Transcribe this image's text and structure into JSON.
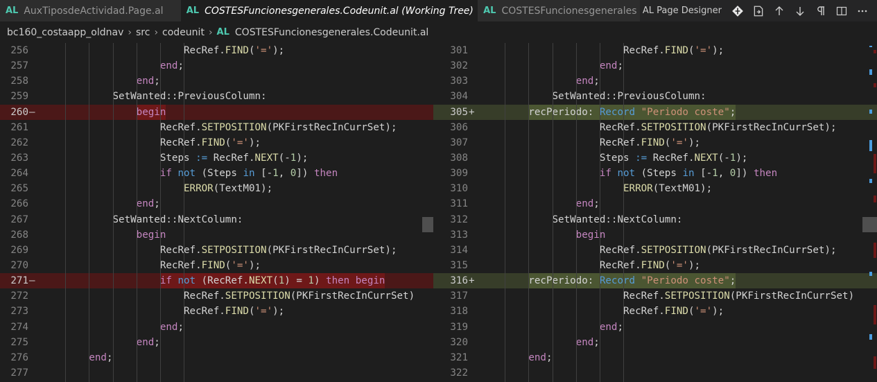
{
  "tabs": [
    {
      "lang": "AL",
      "title": "AuxTiposdeActividad.Page.al",
      "active": false
    },
    {
      "lang": "AL",
      "title": "COSTESFuncionesgenerales.Codeunit.al (Working Tree)",
      "active": true,
      "close": "✕"
    },
    {
      "lang": "AL",
      "title": "COSTESFuncionesgenerales",
      "active": false
    }
  ],
  "actions": {
    "page_designer": "AL Page Designer",
    "icons": [
      "git-compare-icon",
      "open-file-icon",
      "arrow-up-icon",
      "arrow-down-icon",
      "pilcrow-icon",
      "split-editor-icon",
      "more-icon"
    ]
  },
  "breadcrumb": {
    "items": [
      "bc160_costaapp_oldnav",
      "src",
      "codeunit"
    ],
    "file_lang": "AL",
    "file": "COSTESFuncionesgenerales.Codeunit.al"
  },
  "colors": {
    "removed_line": "#4b1818",
    "added_line": "#373d29",
    "editor_bg": "#1e1e1e"
  },
  "left_lines": [
    {
      "n": "256",
      "mark": "",
      "type": "normal",
      "indent": 6,
      "tokens": [
        [
          "RecRef.",
          ""
        ],
        [
          "FIND",
          "fn"
        ],
        [
          "(",
          ""
        ],
        [
          "'='",
          "st"
        ],
        [
          ");",
          ""
        ]
      ]
    },
    {
      "n": "257",
      "mark": "",
      "type": "normal",
      "indent": 5,
      "tokens": [
        [
          "end",
          "ctl"
        ],
        [
          ";",
          ""
        ]
      ]
    },
    {
      "n": "258",
      "mark": "",
      "type": "normal",
      "indent": 4,
      "tokens": [
        [
          "end",
          "ctl"
        ],
        [
          ";",
          ""
        ]
      ]
    },
    {
      "n": "259",
      "mark": "",
      "type": "normal",
      "indent": 3,
      "tokens": [
        [
          "SetWanted::PreviousColumn:",
          ""
        ]
      ]
    },
    {
      "n": "260",
      "mark": "—",
      "type": "removed",
      "indent": 4,
      "tokens": [
        [
          "begin",
          "ctl"
        ]
      ]
    },
    {
      "n": "261",
      "mark": "",
      "type": "normal",
      "indent": 5,
      "tokens": [
        [
          "RecRef.",
          ""
        ],
        [
          "SETPOSITION",
          "fn"
        ],
        [
          "(PKFirstRecInCurrSet);",
          ""
        ]
      ]
    },
    {
      "n": "262",
      "mark": "",
      "type": "normal",
      "indent": 5,
      "tokens": [
        [
          "RecRef.",
          ""
        ],
        [
          "FIND",
          "fn"
        ],
        [
          "(",
          ""
        ],
        [
          "'='",
          "st"
        ],
        [
          ");",
          ""
        ]
      ]
    },
    {
      "n": "263",
      "mark": "",
      "type": "normal",
      "indent": 5,
      "tokens": [
        [
          "Steps ",
          ""
        ],
        [
          ":=",
          "kw"
        ],
        [
          " RecRef.",
          ""
        ],
        [
          "NEXT",
          "fn"
        ],
        [
          "(-",
          ""
        ],
        [
          "1",
          "nm"
        ],
        [
          ");",
          ""
        ]
      ]
    },
    {
      "n": "264",
      "mark": "",
      "type": "normal",
      "indent": 5,
      "tokens": [
        [
          "if",
          "ctl"
        ],
        [
          " ",
          ""
        ],
        [
          "not",
          "kw"
        ],
        [
          " (Steps ",
          ""
        ],
        [
          "in",
          "kw"
        ],
        [
          " [-",
          ""
        ],
        [
          "1",
          "nm"
        ],
        [
          ", ",
          ""
        ],
        [
          "0",
          "nm"
        ],
        [
          "]) ",
          ""
        ],
        [
          "then",
          "ctl"
        ]
      ]
    },
    {
      "n": "265",
      "mark": "",
      "type": "normal",
      "indent": 6,
      "tokens": [
        [
          "ERROR",
          "fn"
        ],
        [
          "(TextM01);",
          ""
        ]
      ]
    },
    {
      "n": "266",
      "mark": "",
      "type": "normal",
      "indent": 4,
      "tokens": [
        [
          "end",
          "ctl"
        ],
        [
          ";",
          ""
        ]
      ]
    },
    {
      "n": "267",
      "mark": "",
      "type": "normal",
      "indent": 3,
      "tokens": [
        [
          "SetWanted::NextColumn:",
          ""
        ]
      ]
    },
    {
      "n": "268",
      "mark": "",
      "type": "normal",
      "indent": 4,
      "tokens": [
        [
          "begin",
          "ctl"
        ]
      ]
    },
    {
      "n": "269",
      "mark": "",
      "type": "normal",
      "indent": 5,
      "tokens": [
        [
          "RecRef.",
          ""
        ],
        [
          "SETPOSITION",
          "fn"
        ],
        [
          "(PKFirstRecInCurrSet);",
          ""
        ]
      ]
    },
    {
      "n": "270",
      "mark": "",
      "type": "normal",
      "indent": 5,
      "tokens": [
        [
          "RecRef.",
          ""
        ],
        [
          "FIND",
          "fn"
        ],
        [
          "(",
          ""
        ],
        [
          "'='",
          "st"
        ],
        [
          ");",
          ""
        ]
      ]
    },
    {
      "n": "271",
      "mark": "—",
      "type": "removed",
      "indent": 5,
      "tokens": [
        [
          "if",
          "ctl"
        ],
        [
          " ",
          ""
        ],
        [
          "not",
          "kw"
        ],
        [
          " (RecRef.",
          ""
        ],
        [
          "NEXT",
          "fn"
        ],
        [
          "(",
          ""
        ],
        [
          "1",
          "nm"
        ],
        [
          ") = ",
          ""
        ],
        [
          "1",
          "nm"
        ],
        [
          ") ",
          ""
        ],
        [
          "then",
          "ctl"
        ],
        [
          " ",
          ""
        ],
        [
          "begin",
          "ctl"
        ]
      ]
    },
    {
      "n": "272",
      "mark": "",
      "type": "normal",
      "indent": 6,
      "tokens": [
        [
          "RecRef.",
          ""
        ],
        [
          "SETPOSITION",
          "fn"
        ],
        [
          "(PKFirstRecInCurrSet)",
          ""
        ]
      ]
    },
    {
      "n": "273",
      "mark": "",
      "type": "normal",
      "indent": 6,
      "tokens": [
        [
          "RecRef.",
          ""
        ],
        [
          "FIND",
          "fn"
        ],
        [
          "(",
          ""
        ],
        [
          "'='",
          "st"
        ],
        [
          ");",
          ""
        ]
      ]
    },
    {
      "n": "274",
      "mark": "",
      "type": "normal",
      "indent": 5,
      "tokens": [
        [
          "end",
          "ctl"
        ],
        [
          ";",
          ""
        ]
      ]
    },
    {
      "n": "275",
      "mark": "",
      "type": "normal",
      "indent": 4,
      "tokens": [
        [
          "end",
          "ctl"
        ],
        [
          ";",
          ""
        ]
      ]
    },
    {
      "n": "276",
      "mark": "",
      "type": "normal",
      "indent": 2,
      "tokens": [
        [
          "end",
          "ctl"
        ],
        [
          ";",
          ""
        ]
      ]
    },
    {
      "n": "277",
      "mark": "",
      "type": "normal",
      "indent": 0,
      "tokens": []
    }
  ],
  "right_lines": [
    {
      "n": "301",
      "mark": "",
      "type": "normal",
      "indent": 6,
      "tokens": [
        [
          "RecRef.",
          ""
        ],
        [
          "FIND",
          "fn"
        ],
        [
          "(",
          ""
        ],
        [
          "'='",
          "st"
        ],
        [
          ");",
          ""
        ]
      ]
    },
    {
      "n": "302",
      "mark": "",
      "type": "normal",
      "indent": 5,
      "tokens": [
        [
          "end",
          "ctl"
        ],
        [
          ";",
          ""
        ]
      ]
    },
    {
      "n": "303",
      "mark": "",
      "type": "normal",
      "indent": 4,
      "tokens": [
        [
          "end",
          "ctl"
        ],
        [
          ";",
          ""
        ]
      ]
    },
    {
      "n": "304",
      "mark": "",
      "type": "normal",
      "indent": 3,
      "tokens": [
        [
          "SetWanted::PreviousColumn:",
          ""
        ]
      ]
    },
    {
      "n": "305",
      "mark": "+",
      "type": "added",
      "indent": 2,
      "tokens": [
        [
          "recPeriodo",
          ""
        ],
        [
          ": ",
          ""
        ],
        [
          "Record",
          "kw"
        ],
        [
          " ",
          ""
        ],
        [
          "\"Periodo coste\"",
          "st"
        ],
        [
          ";",
          ""
        ]
      ]
    },
    {
      "n": "306",
      "mark": "",
      "type": "normal",
      "indent": 5,
      "tokens": [
        [
          "RecRef.",
          ""
        ],
        [
          "SETPOSITION",
          "fn"
        ],
        [
          "(PKFirstRecInCurrSet);",
          ""
        ]
      ]
    },
    {
      "n": "307",
      "mark": "",
      "type": "normal",
      "indent": 5,
      "tokens": [
        [
          "RecRef.",
          ""
        ],
        [
          "FIND",
          "fn"
        ],
        [
          "(",
          ""
        ],
        [
          "'='",
          "st"
        ],
        [
          ");",
          ""
        ]
      ]
    },
    {
      "n": "308",
      "mark": "",
      "type": "normal",
      "indent": 5,
      "tokens": [
        [
          "Steps ",
          ""
        ],
        [
          ":=",
          "kw"
        ],
        [
          " RecRef.",
          ""
        ],
        [
          "NEXT",
          "fn"
        ],
        [
          "(-",
          ""
        ],
        [
          "1",
          "nm"
        ],
        [
          ");",
          ""
        ]
      ]
    },
    {
      "n": "309",
      "mark": "",
      "type": "normal",
      "indent": 5,
      "tokens": [
        [
          "if",
          "ctl"
        ],
        [
          " ",
          ""
        ],
        [
          "not",
          "kw"
        ],
        [
          " (Steps ",
          ""
        ],
        [
          "in",
          "kw"
        ],
        [
          " [-",
          ""
        ],
        [
          "1",
          "nm"
        ],
        [
          ", ",
          ""
        ],
        [
          "0",
          "nm"
        ],
        [
          "]) ",
          ""
        ],
        [
          "then",
          "ctl"
        ]
      ]
    },
    {
      "n": "310",
      "mark": "",
      "type": "normal",
      "indent": 6,
      "tokens": [
        [
          "ERROR",
          "fn"
        ],
        [
          "(TextM01);",
          ""
        ]
      ]
    },
    {
      "n": "311",
      "mark": "",
      "type": "normal",
      "indent": 4,
      "tokens": [
        [
          "end",
          "ctl"
        ],
        [
          ";",
          ""
        ]
      ]
    },
    {
      "n": "312",
      "mark": "",
      "type": "normal",
      "indent": 3,
      "tokens": [
        [
          "SetWanted::NextColumn:",
          ""
        ]
      ]
    },
    {
      "n": "313",
      "mark": "",
      "type": "normal",
      "indent": 4,
      "tokens": [
        [
          "begin",
          "ctl"
        ]
      ]
    },
    {
      "n": "314",
      "mark": "",
      "type": "normal",
      "indent": 5,
      "tokens": [
        [
          "RecRef.",
          ""
        ],
        [
          "SETPOSITION",
          "fn"
        ],
        [
          "(PKFirstRecInCurrSet);",
          ""
        ]
      ]
    },
    {
      "n": "315",
      "mark": "",
      "type": "normal",
      "indent": 5,
      "tokens": [
        [
          "RecRef.",
          ""
        ],
        [
          "FIND",
          "fn"
        ],
        [
          "(",
          ""
        ],
        [
          "'='",
          "st"
        ],
        [
          ");",
          ""
        ]
      ]
    },
    {
      "n": "316",
      "mark": "+",
      "type": "added",
      "indent": 2,
      "tokens": [
        [
          "recPeriodo",
          ""
        ],
        [
          ": ",
          ""
        ],
        [
          "Record",
          "kw"
        ],
        [
          " ",
          ""
        ],
        [
          "\"Periodo coste\"",
          "st"
        ],
        [
          ";",
          ""
        ]
      ]
    },
    {
      "n": "317",
      "mark": "",
      "type": "normal",
      "indent": 6,
      "tokens": [
        [
          "RecRef.",
          ""
        ],
        [
          "SETPOSITION",
          "fn"
        ],
        [
          "(PKFirstRecInCurrSet)",
          ""
        ]
      ]
    },
    {
      "n": "318",
      "mark": "",
      "type": "normal",
      "indent": 6,
      "tokens": [
        [
          "RecRef.",
          ""
        ],
        [
          "FIND",
          "fn"
        ],
        [
          "(",
          ""
        ],
        [
          "'='",
          "st"
        ],
        [
          ");",
          ""
        ]
      ]
    },
    {
      "n": "319",
      "mark": "",
      "type": "normal",
      "indent": 5,
      "tokens": [
        [
          "end",
          "ctl"
        ],
        [
          ";",
          ""
        ]
      ]
    },
    {
      "n": "320",
      "mark": "",
      "type": "normal",
      "indent": 4,
      "tokens": [
        [
          "end",
          "ctl"
        ],
        [
          ";",
          ""
        ]
      ]
    },
    {
      "n": "321",
      "mark": "",
      "type": "normal",
      "indent": 2,
      "tokens": [
        [
          "end",
          "ctl"
        ],
        [
          ";",
          ""
        ]
      ]
    },
    {
      "n": "322",
      "mark": "",
      "type": "normal",
      "indent": 0,
      "tokens": []
    }
  ]
}
